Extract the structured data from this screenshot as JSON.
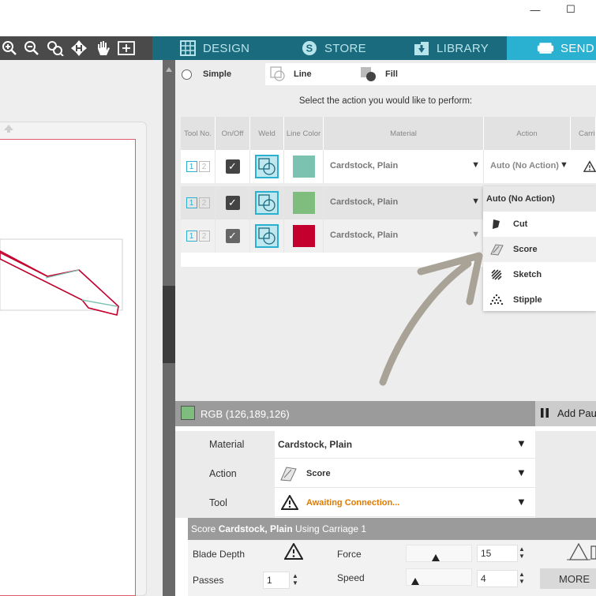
{
  "window": {
    "minimize_glyph": "—",
    "maximize_glyph": "☐"
  },
  "toolbar": {
    "icons": [
      "zoom-in-icon",
      "zoom-out-icon",
      "zoom-fit-icon",
      "move-icon",
      "pan-icon",
      "add-page-icon"
    ]
  },
  "nav": {
    "tabs": [
      {
        "label": "DESIGN",
        "icon": "grid-icon"
      },
      {
        "label": "STORE",
        "icon": "silhouette-s-icon"
      },
      {
        "label": "LIBRARY",
        "icon": "library-icon"
      },
      {
        "label": "SEND",
        "icon": "cutter-icon"
      }
    ]
  },
  "line_tabs": {
    "simple": "Simple",
    "line": "Line",
    "fill": "Fill"
  },
  "prompt": "Select the action you would like to perform:",
  "table": {
    "headers": [
      "Tool No.",
      "On/Off",
      "Weld",
      "Line Color",
      "Material",
      "Action",
      "Carri"
    ],
    "rows": [
      {
        "tool1": "1",
        "tool2": "2",
        "checked": "✓",
        "color": "#7cc2b0",
        "material": "Cardstock, Plain",
        "dropdown": "▼"
      },
      {
        "tool1": "1",
        "tool2": "2",
        "checked": "✓",
        "color": "#7ebd7e",
        "material": "Cardstock, Plain",
        "dropdown": "▼"
      },
      {
        "tool1": "1",
        "tool2": "2",
        "checked": "✓",
        "color": "#c4002e",
        "material": "Cardstock, Plain",
        "dropdown": "▼"
      }
    ],
    "action_value": "Auto (No Action)",
    "action_arrow": "▼"
  },
  "action_menu": {
    "items": [
      {
        "label": "Auto (No Action)",
        "icon": ""
      },
      {
        "label": "Cut",
        "icon": "blade-icon"
      },
      {
        "label": "Score",
        "icon": "score-icon"
      },
      {
        "label": "Sketch",
        "icon": "sketch-icon"
      },
      {
        "label": "Stipple",
        "icon": "stipple-icon"
      }
    ]
  },
  "bottom": {
    "color_label": "RGB (126,189,126)",
    "color_swatch": "#7ebd7e",
    "add_pause": "Add Pau",
    "material_label": "Material",
    "material_value": "Cardstock, Plain",
    "action_label": "Action",
    "action_value": "Score",
    "tool_label": "Tool",
    "tool_value": "Awaiting Connection...",
    "arrow": "▼",
    "score_prefix": "Score ",
    "score_material": "Cardstock, Plain",
    "score_suffix": " Using Carriage 1",
    "blade_depth": "Blade Depth",
    "force_label": "Force",
    "force_value": "15",
    "passes_label": "Passes",
    "passes_value": "1",
    "speed_label": "Speed",
    "speed_value": "4",
    "more": "MORE"
  },
  "colors": {
    "accent": "#2ab0d0",
    "nav_bg": "#1a6b7e",
    "warning": "#e07b00"
  }
}
